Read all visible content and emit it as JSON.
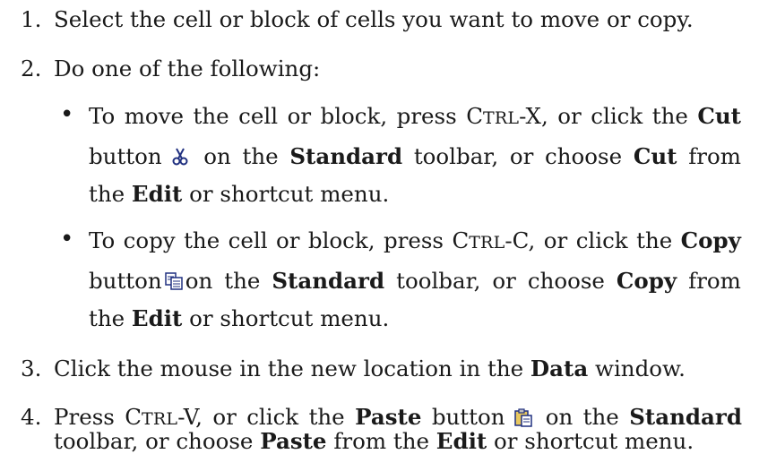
{
  "steps": [
    {
      "number": "1.",
      "text": "Select the cell or block of cells you want to move or copy."
    },
    {
      "number": "2.",
      "text": "Do one of the following:"
    },
    {
      "number": "3.",
      "text_before": "Click the mouse in the new location in the ",
      "bold": "Data",
      "text_after": " window."
    },
    {
      "number": "4.",
      "line1": {
        "a": "Press ",
        "key_ctrl_first": "C",
        "key_ctrl_rest": "TRL",
        "key_suffix": "-V, or click the ",
        "bold1": "Paste",
        "b": " button ",
        "c": " on the ",
        "bold2": "Standard"
      },
      "line2": {
        "a": "toolbar, or choose ",
        "bold1": "Paste",
        "b": " from the ",
        "bold2": "Edit",
        "c": " or shortcut menu."
      }
    }
  ],
  "bullets": [
    {
      "symbol": "•",
      "line1": {
        "a": "To move the cell or block, press ",
        "key_ctrl_first": "C",
        "key_ctrl_rest": "TRL",
        "key_suffix": "-X, or click the ",
        "bold1": "Cut"
      },
      "line2": {
        "a": "button ",
        "b": " on the ",
        "bold1": "Standard",
        "c": " toolbar, or choose ",
        "bold2": "Cut",
        "d": " from"
      },
      "line3": {
        "a": "the ",
        "bold1": "Edit",
        "b": " or shortcut menu."
      },
      "icon": "cut-scissors-icon"
    },
    {
      "symbol": "•",
      "line1": {
        "a": "To copy the cell or block, press ",
        "key_ctrl_first": "C",
        "key_ctrl_rest": "TRL",
        "key_suffix": "-C, or click the ",
        "bold1": "Copy"
      },
      "line2": {
        "a": "button ",
        "b": " on the ",
        "bold1": "Standard",
        "c": " toolbar, or choose ",
        "bold2": "Copy",
        "d": " from"
      },
      "line3": {
        "a": "the ",
        "bold1": "Edit",
        "b": " or shortcut menu."
      },
      "icon": "copy-pages-icon"
    }
  ],
  "paste_icon": "paste-clipboard-icon"
}
